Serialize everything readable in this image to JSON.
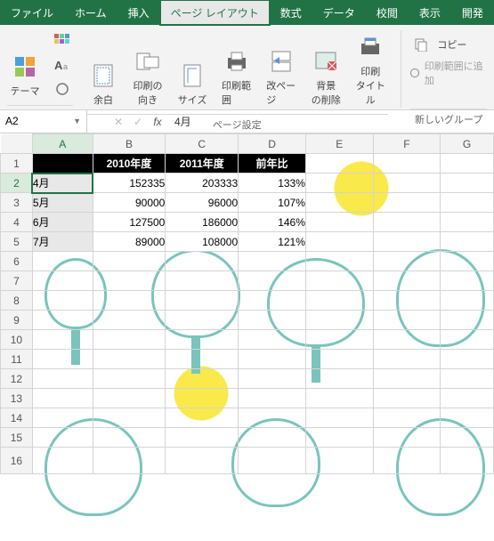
{
  "tabs": {
    "file": "ファイル",
    "home": "ホーム",
    "insert": "挿入",
    "layout": "ページ レイアウト",
    "formulas": "数式",
    "data": "データ",
    "review": "校閲",
    "view": "表示",
    "developer": "開発"
  },
  "ribbon": {
    "themes_label": "テーマ",
    "theme_btn": "テーマ",
    "margins": "余白",
    "orientation": "印刷の\n向き",
    "size": "サイズ",
    "print_area": "印刷範囲",
    "breaks": "改ページ",
    "background": "背景\nの削除",
    "print_titles": "印刷\nタイトル",
    "page_setup_label": "ページ設定",
    "copy": "コピー",
    "add_to_print_area": "印刷範囲に追加",
    "new_group_label": "新しいグループ"
  },
  "fbar": {
    "cell_ref": "A2",
    "formula": "4月"
  },
  "grid": {
    "cols": [
      "A",
      "B",
      "C",
      "D",
      "E",
      "F",
      "G"
    ],
    "header": {
      "b": "2010年度",
      "c": "2011年度",
      "d": "前年比"
    },
    "rows": [
      {
        "a": "4月",
        "b": "152335",
        "c": "203333",
        "d": "133%"
      },
      {
        "a": "5月",
        "b": "90000",
        "c": "96000",
        "d": "107%"
      },
      {
        "a": "6月",
        "b": "127500",
        "c": "186000",
        "d": "146%"
      },
      {
        "a": "7月",
        "b": "89000",
        "c": "108000",
        "d": "121%"
      }
    ]
  },
  "chart_data": {
    "type": "table",
    "title": "",
    "columns": [
      "",
      "2010年度",
      "2011年度",
      "前年比"
    ],
    "rows": [
      [
        "4月",
        152335,
        203333,
        "133%"
      ],
      [
        "5月",
        90000,
        96000,
        "107%"
      ],
      [
        "6月",
        127500,
        186000,
        "146%"
      ],
      [
        "7月",
        89000,
        108000,
        "121%"
      ]
    ]
  }
}
